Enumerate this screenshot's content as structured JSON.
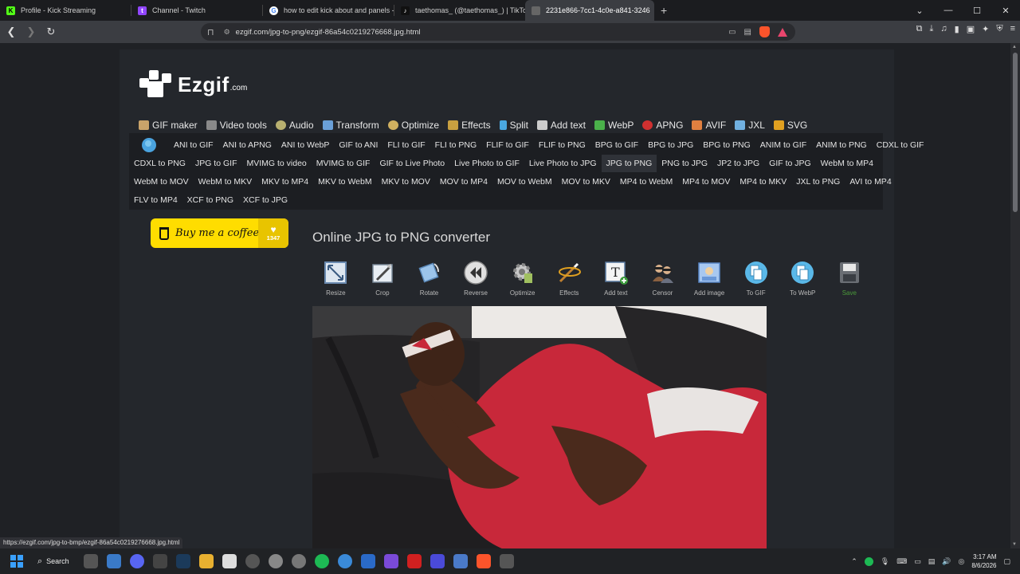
{
  "tabs": [
    {
      "label": "Profile - Kick Streaming",
      "icon": "kick-icon",
      "color": "#53fc18"
    },
    {
      "label": "Channel - Twitch",
      "icon": "twitch-icon",
      "color": "#9146ff"
    },
    {
      "label": "how to edit kick about and panels - G",
      "icon": "google-icon",
      "color": "#ffffff"
    },
    {
      "label": "taethomas_ (@taethomas_) | TikTok",
      "icon": "tiktok-icon",
      "color": "#111111"
    },
    {
      "label": "2231e866-7cc1-4c0e-a841-3246",
      "icon": "page-icon",
      "color": "#888888"
    }
  ],
  "address": {
    "url": "ezgif.com/jpg-to-png/ezgif-86a54c0219276668.jpg.html"
  },
  "logo": {
    "text": "Ezgif",
    "suffix": ".com"
  },
  "main_nav": [
    {
      "label": "GIF maker",
      "color": "#c9a36a"
    },
    {
      "label": "Video tools",
      "color": "#8a8a8a"
    },
    {
      "label": "Audio",
      "color": "#b8b070"
    },
    {
      "label": "Transform",
      "color": "#6aa0d8"
    },
    {
      "label": "Optimize",
      "color": "#d0b060"
    },
    {
      "label": "Effects",
      "color": "#c8a040"
    },
    {
      "label": "Split",
      "color": "#4aa8e0"
    },
    {
      "label": "Add text",
      "color": "#cccccc"
    },
    {
      "label": "WebP",
      "color": "#4ab04a"
    },
    {
      "label": "APNG",
      "color": "#d03030"
    },
    {
      "label": "AVIF",
      "color": "#e08040"
    },
    {
      "label": "JXL",
      "color": "#70b0e0"
    },
    {
      "label": "SVG",
      "color": "#e0a020"
    }
  ],
  "sub_nav": {
    "row1": [
      "ANI to GIF",
      "ANI to APNG",
      "ANI to WebP",
      "GIF to ANI",
      "FLI to GIF",
      "FLI to PNG",
      "FLIF to GIF",
      "FLIF to PNG",
      "BPG to GIF",
      "BPG to JPG",
      "BPG to PNG",
      "ANIM to GIF",
      "ANIM to PNG",
      "CDXL to GIF"
    ],
    "row2": [
      "CDXL to PNG",
      "JPG to GIF",
      "MVIMG to video",
      "MVIMG to GIF",
      "GIF to Live Photo",
      "Live Photo to GIF",
      "Live Photo to JPG",
      "JPG to PNG",
      "PNG to JPG",
      "JP2 to JPG",
      "GIF to JPG",
      "WebM to MP4"
    ],
    "row3": [
      "WebM to MOV",
      "WebM to MKV",
      "MKV to MP4",
      "MKV to WebM",
      "MKV to MOV",
      "MOV to MP4",
      "MOV to WebM",
      "MOV to MKV",
      "MP4 to WebM",
      "MP4 to MOV",
      "MP4 to MKV",
      "JXL to PNG",
      "AVI to MP4"
    ],
    "row4": [
      "FLV to MP4",
      "XCF to PNG",
      "XCF to JPG"
    ],
    "active": "JPG to PNG"
  },
  "coffee": {
    "label": "Buy me a coffee",
    "count": "1347"
  },
  "page_title": "Online JPG to PNG converter",
  "tools": [
    {
      "label": "Resize",
      "icon": "resize-icon"
    },
    {
      "label": "Crop",
      "icon": "crop-icon"
    },
    {
      "label": "Rotate",
      "icon": "rotate-icon"
    },
    {
      "label": "Reverse",
      "icon": "reverse-icon"
    },
    {
      "label": "Optimize",
      "icon": "optimize-icon"
    },
    {
      "label": "Effects",
      "icon": "effects-icon"
    },
    {
      "label": "Add text",
      "icon": "add-text-icon"
    },
    {
      "label": "Censor",
      "icon": "censor-icon"
    },
    {
      "label": "Add image",
      "icon": "add-image-icon"
    },
    {
      "label": "To GIF",
      "icon": "to-gif-icon"
    },
    {
      "label": "To WebP",
      "icon": "to-webp-icon"
    },
    {
      "label": "Save",
      "icon": "save-icon"
    }
  ],
  "status_url": "https://ezgif.com/jpg-to-bmp/ezgif-86a54c0219276668.jpg.html",
  "taskbar": {
    "search": "Search",
    "time": "3:17 AM",
    "date": "8/6/2026"
  }
}
